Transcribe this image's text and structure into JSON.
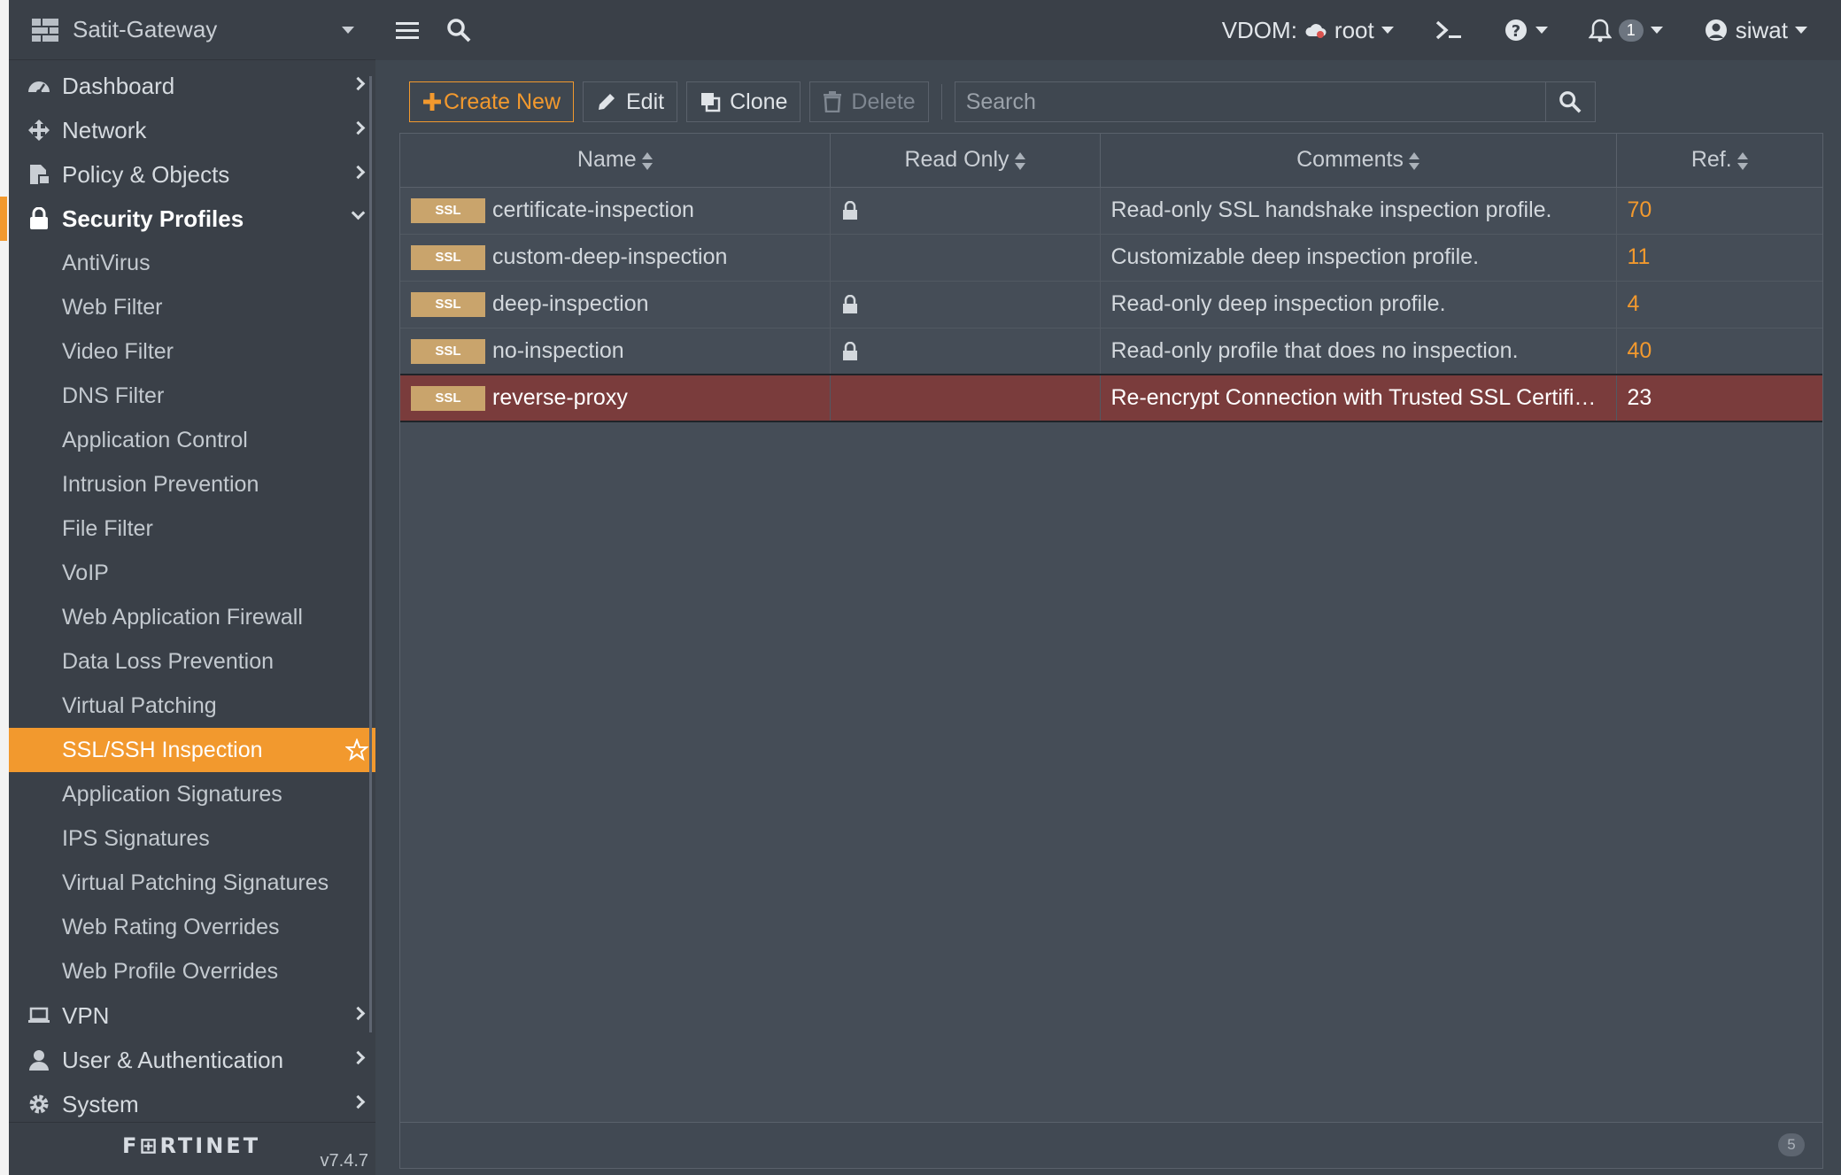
{
  "sidebar": {
    "device_name": "Satit-Gateway",
    "nav": [
      {
        "label": "Dashboard",
        "icon": "dashboard-icon"
      },
      {
        "label": "Network",
        "icon": "network-icon"
      },
      {
        "label": "Policy & Objects",
        "icon": "policy-icon"
      },
      {
        "label": "Security Profiles",
        "icon": "lock-icon"
      }
    ],
    "security_profiles": [
      "AntiVirus",
      "Web Filter",
      "Video Filter",
      "DNS Filter",
      "Application Control",
      "Intrusion Prevention",
      "File Filter",
      "VoIP",
      "Web Application Firewall",
      "Data Loss Prevention",
      "Virtual Patching",
      "SSL/SSH Inspection",
      "Application Signatures",
      "IPS Signatures",
      "Virtual Patching Signatures",
      "Web Rating Overrides",
      "Web Profile Overrides"
    ],
    "nav_bottom": [
      {
        "label": "VPN",
        "icon": "laptop-icon"
      },
      {
        "label": "User & Authentication",
        "icon": "user-icon"
      },
      {
        "label": "System",
        "icon": "gear-icon"
      }
    ],
    "brand": "F⊞RTINET",
    "version": "v7.4.7"
  },
  "topbar": {
    "vdom_label": "VDOM:",
    "vdom_value": "root",
    "notification_count": "1",
    "user": "siwat"
  },
  "toolbar": {
    "create_label": "Create New",
    "edit_label": "Edit",
    "clone_label": "Clone",
    "delete_label": "Delete",
    "search_placeholder": "Search"
  },
  "table": {
    "headers": [
      "Name",
      "Read Only",
      "Comments",
      "Ref."
    ],
    "tag": "SSL",
    "rows": [
      {
        "name": "certificate-inspection",
        "read_only": true,
        "comment": "Read-only SSL handshake inspection profile.",
        "ref": "70"
      },
      {
        "name": "custom-deep-inspection",
        "read_only": false,
        "comment": "Customizable deep inspection profile.",
        "ref": "11"
      },
      {
        "name": "deep-inspection",
        "read_only": true,
        "comment": "Read-only deep inspection profile.",
        "ref": "4"
      },
      {
        "name": "no-inspection",
        "read_only": true,
        "comment": "Read-only profile that does no inspection.",
        "ref": "40"
      },
      {
        "name": "reverse-proxy",
        "read_only": false,
        "comment": "Re-encrypt Connection with Trusted SSL Certifica...",
        "ref": "23"
      }
    ],
    "total": "5"
  },
  "colors": {
    "accent": "#f2992e",
    "selected_row": "#7a3c3c",
    "ssl_tag": "#c9a46c"
  }
}
